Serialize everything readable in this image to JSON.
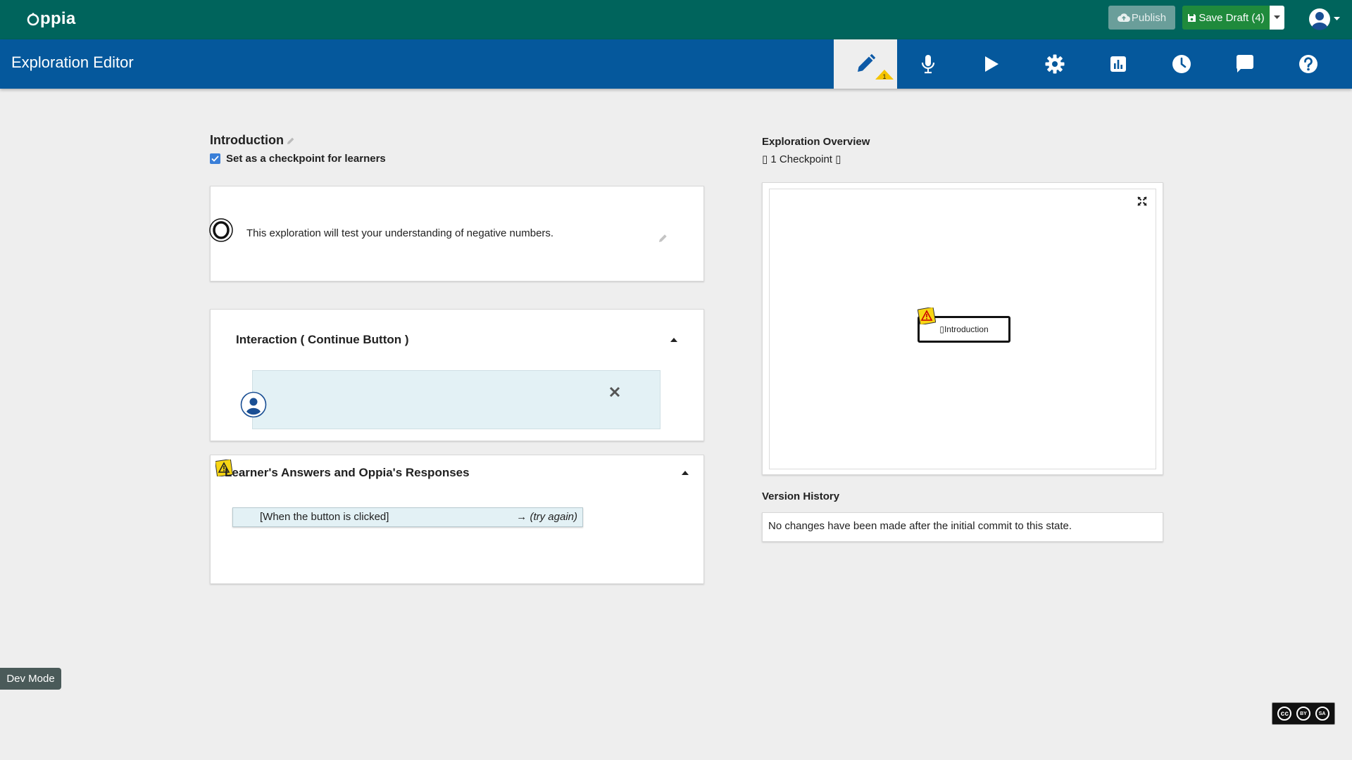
{
  "topbar": {
    "logo_text": "ppia",
    "publish_label": "Publish",
    "save_label": "Save Draft (4)"
  },
  "subnav": {
    "title": "Exploration Editor",
    "tabs": [
      {
        "name": "editor",
        "icon": "pencil-icon",
        "badge": "1"
      },
      {
        "name": "translation",
        "icon": "microphone-icon"
      },
      {
        "name": "preview",
        "icon": "play-icon"
      },
      {
        "name": "settings",
        "icon": "gear-icon"
      },
      {
        "name": "statistics",
        "icon": "bar-chart-icon"
      },
      {
        "name": "history",
        "icon": "clock-icon"
      },
      {
        "name": "feedback",
        "icon": "comment-icon"
      },
      {
        "name": "help",
        "icon": "question-icon"
      }
    ]
  },
  "state": {
    "name": "Introduction",
    "checkpoint_label": "Set as a checkpoint for learners"
  },
  "content": {
    "text": "This exploration will test your understanding of negative numbers."
  },
  "interaction": {
    "title": "Interaction ( Continue Button )"
  },
  "responses": {
    "title": "Learner's Answers and Oppia's Responses",
    "rule_text": "[When the button is clicked]",
    "rule_dest": "→ (try again)"
  },
  "overview": {
    "title": "Exploration Overview",
    "subtitle": "▯ 1 Checkpoint ▯",
    "node_label": "▯Introduction"
  },
  "version": {
    "title": "Version History",
    "text": "No changes have been made after the initial commit to this state."
  },
  "dev_mode_label": "Dev Mode",
  "license": {
    "cc": "cc",
    "by": "BY",
    "sa": "SA"
  },
  "colors": {
    "topbar": "#00645c",
    "subnav": "#05589c",
    "save": "#1f8a3c",
    "publish": "#6a9e9a"
  }
}
